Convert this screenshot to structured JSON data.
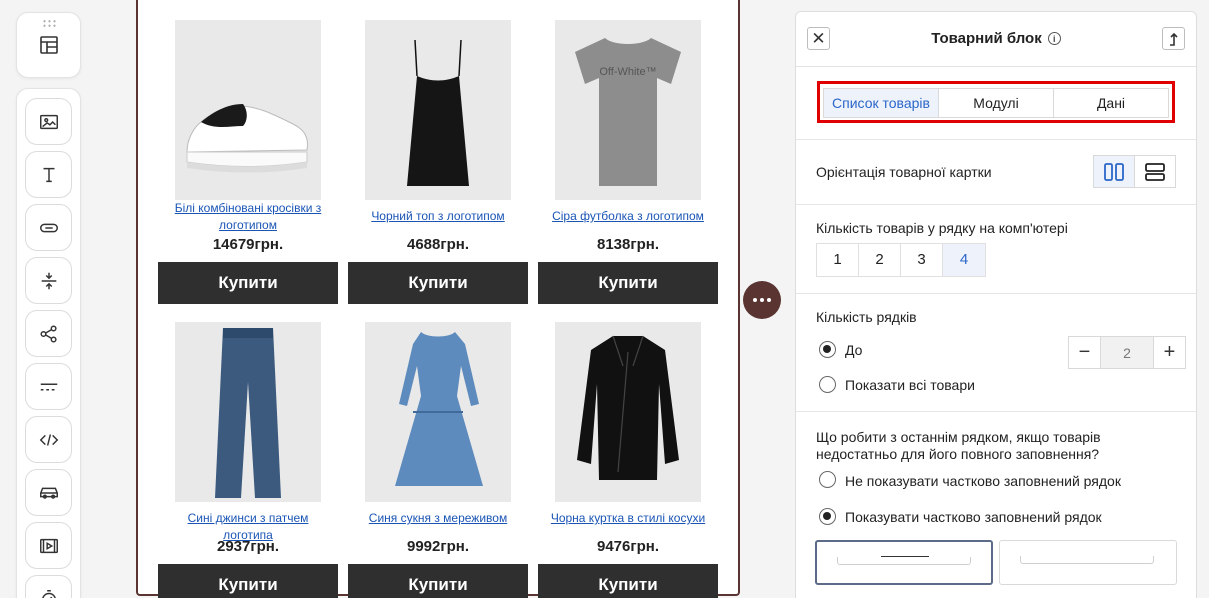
{
  "canvas": {
    "products": [
      {
        "name": "Білі комбіновані кросівки з логотипом",
        "price": "14679грн.",
        "buy_label": "Купити",
        "image": "sneaker"
      },
      {
        "name": "Чорний топ з логотипом",
        "price": "4688грн.",
        "buy_label": "Купити",
        "image": "black-top"
      },
      {
        "name": "Сіра футболка з логотипом",
        "price": "8138грн.",
        "buy_label": "Купити",
        "image": "gray-tshirt",
        "print": "Off-White™"
      },
      {
        "name": "Сині джинси з патчем логотипа",
        "price": "2937грн.",
        "buy_label": "Купити",
        "image": "jeans"
      },
      {
        "name": "Синя сукня з мереживом",
        "price": "9992грн.",
        "buy_label": "Купити",
        "image": "blue-dress"
      },
      {
        "name": "Чорна куртка в стилі косухи",
        "price": "9476грн.",
        "buy_label": "Купити",
        "image": "leather-jacket"
      }
    ]
  },
  "panel": {
    "title": "Товарний блок",
    "info_glyph": "i",
    "tabs": [
      {
        "label": "Список товарів",
        "active": true
      },
      {
        "label": "Модулі",
        "active": false
      },
      {
        "label": "Дані",
        "active": false
      }
    ],
    "orientation_label": "Орієнтація товарної картки",
    "per_row_label": "Кількість товарів у рядку на комп'ютері",
    "per_row_options": [
      "1",
      "2",
      "3",
      "4"
    ],
    "per_row_selected": "4",
    "rows_label": "Кількість рядків",
    "rows_option_up_to": "До",
    "rows_option_all": "Показати всі товари",
    "rows_value": "2",
    "last_row_question": "Що робити з останнім рядком, якщо товарів недостатньо для його повного заповнення?",
    "last_row_hide": "Не показувати частково заповнений рядок",
    "last_row_show": "Показувати частково заповнений рядок"
  },
  "colors": {
    "accent": "#2b66c8",
    "highlight": "#e00000",
    "canvas_border": "#5a3431",
    "button_dark": "#2f2f2f"
  }
}
